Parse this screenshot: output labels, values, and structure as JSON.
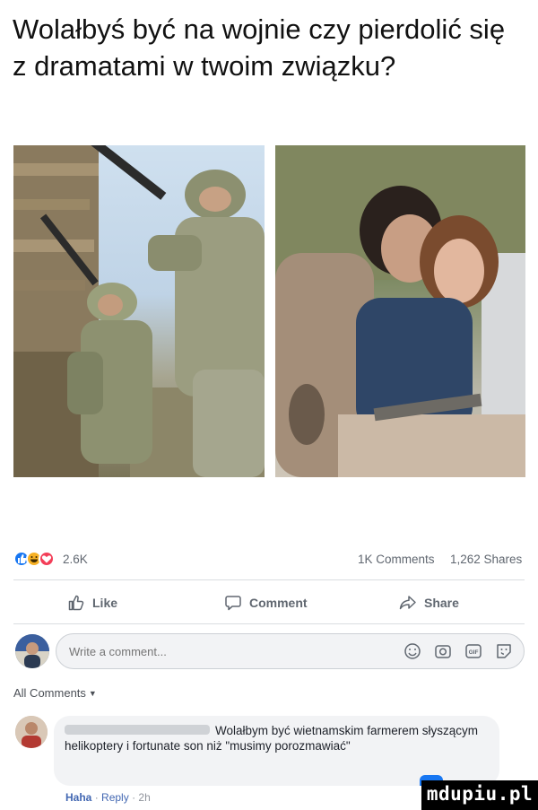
{
  "post": {
    "title": "Wolałbyś być na wojnie czy pierdolić się z dramatami w twoim związku?"
  },
  "photos": {
    "left_icon": "soldiers-photo",
    "right_icon": "couple-photo"
  },
  "reactions": {
    "count": "2.6K",
    "icons": [
      "like-icon",
      "haha-icon",
      "love-icon"
    ],
    "like_color": "#1877f2",
    "haha_color": "#f7b125",
    "love_color": "#f33e58"
  },
  "stats": {
    "comments": "1K Comments",
    "shares": "1,262 Shares"
  },
  "actions": {
    "like": "Like",
    "comment": "Comment",
    "share": "Share"
  },
  "composer": {
    "placeholder": "Write a comment...",
    "tools": [
      "emoji-icon",
      "camera-icon",
      "gif-icon",
      "sticker-icon"
    ]
  },
  "comments_header": {
    "label": "All Comments"
  },
  "comment": {
    "text": "Wolałbym być wietnamskim farmerem słyszącym helikoptery i fortunate son niż \"musimy porozmawiać\"",
    "reaction": "Haha",
    "reply": "Reply",
    "age": "2h"
  },
  "watermark": {
    "text": "mdupiu.pl"
  }
}
